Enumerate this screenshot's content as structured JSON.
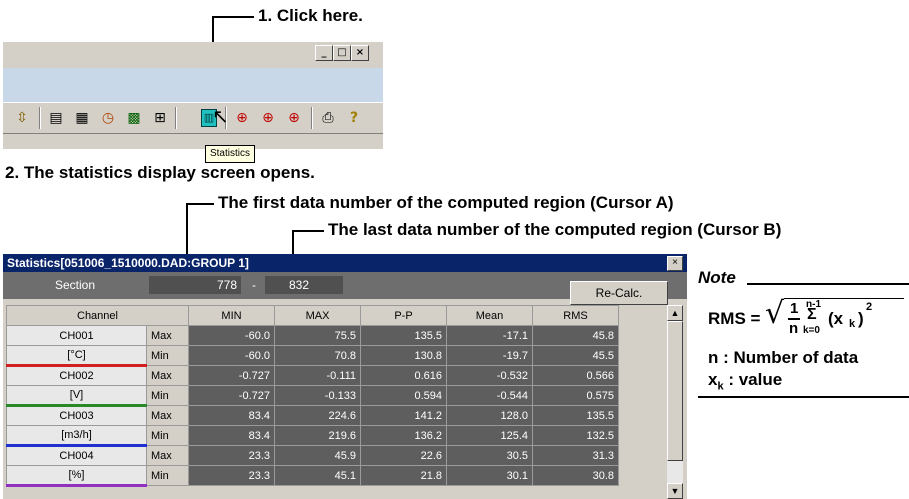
{
  "callouts": {
    "step1": "1. Click here.",
    "step2": "2. The statistics display screen opens.",
    "cursor_a": "The first data number of the computed region (Cursor A)",
    "cursor_b": "The last data number of the computed region (Cursor B)"
  },
  "toolbar_window": {
    "buttons": {
      "minimize": "_",
      "maximize": "□",
      "close": "×"
    },
    "tooltip": "Statistics",
    "icons": [
      "zoom-icon",
      "chart-icon",
      "table-icon",
      "clock-icon",
      "grid-icon",
      "split-icon",
      "statistics-icon",
      "cursor-left-icon",
      "cursor-both-icon",
      "cursor-right-icon",
      "print-icon",
      "help-icon"
    ]
  },
  "statistics_window": {
    "title": "Statistics[051006_1510000.DAD:GROUP 1]",
    "close": "×",
    "section": {
      "label": "Section",
      "start": "778",
      "separator": "-",
      "end": "832"
    },
    "recalc_label": "Re-Calc.",
    "columns": [
      "Channel",
      "MIN",
      "MAX",
      "P-P",
      "Mean",
      "RMS"
    ],
    "channels": [
      {
        "name": "CH001",
        "unit": "[°C]",
        "color": "#d02020",
        "max_row": {
          "label": "Max",
          "values": [
            "-60.0",
            "75.5",
            "135.5",
            "-17.1",
            "45.8"
          ]
        },
        "min_row": {
          "label": "Min",
          "values": [
            "-60.0",
            "70.8",
            "130.8",
            "-19.7",
            "45.5"
          ]
        }
      },
      {
        "name": "CH002",
        "unit": "[V]",
        "color": "#2a8a2a",
        "max_row": {
          "label": "Max",
          "values": [
            "-0.727",
            "-0.111",
            "0.616",
            "-0.532",
            "0.566"
          ]
        },
        "min_row": {
          "label": "Min",
          "values": [
            "-0.727",
            "-0.133",
            "0.594",
            "-0.544",
            "0.575"
          ]
        }
      },
      {
        "name": "CH003",
        "unit": "[m3/h]",
        "color": "#2030d0",
        "max_row": {
          "label": "Max",
          "values": [
            "83.4",
            "224.6",
            "141.2",
            "128.0",
            "135.5"
          ]
        },
        "min_row": {
          "label": "Min",
          "values": [
            "83.4",
            "219.6",
            "136.2",
            "125.4",
            "132.5"
          ]
        }
      },
      {
        "name": "CH004",
        "unit": "[%]",
        "color": "#9030c0",
        "max_row": {
          "label": "Max",
          "values": [
            "23.3",
            "45.9",
            "22.6",
            "30.5",
            "31.3"
          ]
        },
        "min_row": {
          "label": "Min",
          "values": [
            "23.3",
            "45.1",
            "21.8",
            "30.1",
            "30.8"
          ]
        }
      }
    ]
  },
  "note": {
    "title": "Note",
    "formula_lhs": "RMS =",
    "formula_frac_num": "1",
    "formula_frac_den": "n",
    "formula_sum_top": "n-1",
    "formula_sum_bottom": "k=0",
    "formula_term": "(x",
    "formula_sub": "k",
    "formula_close": ")",
    "formula_exp": "2",
    "def_n": "n  : Number of data",
    "def_x_base": "x",
    "def_x_sub": "k",
    "def_x_rest": " : value"
  }
}
